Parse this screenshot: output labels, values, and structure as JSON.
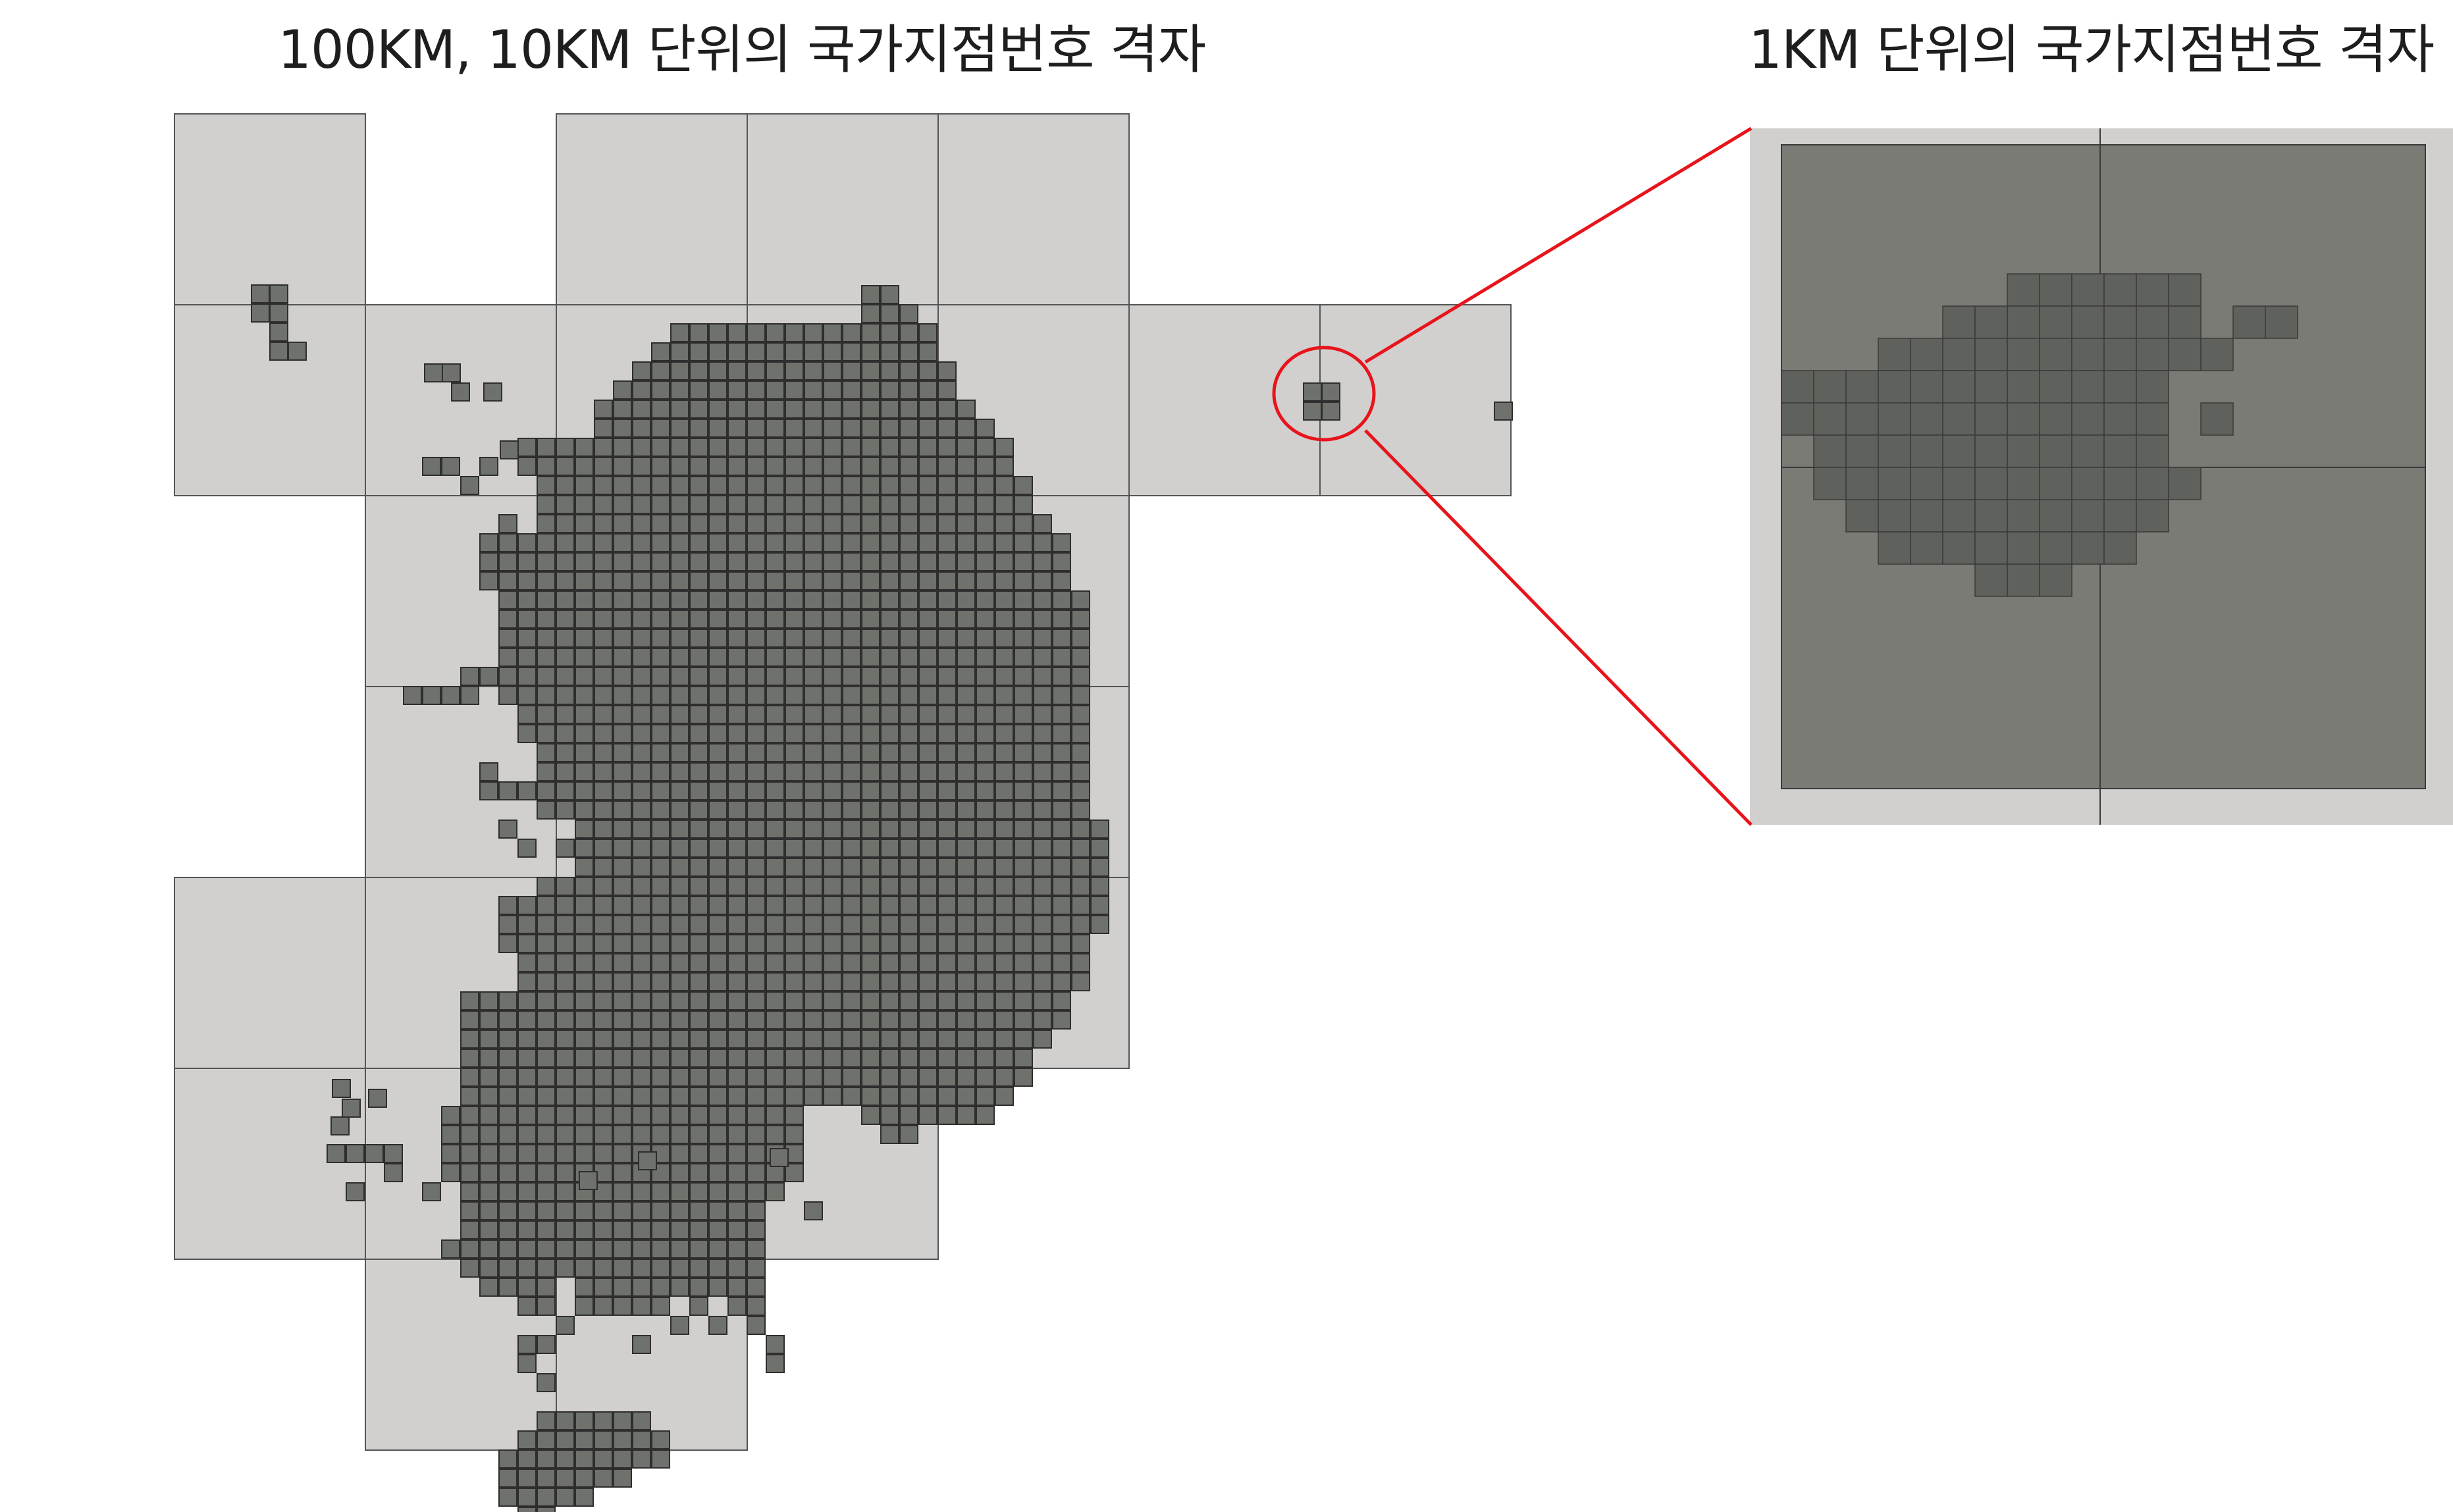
{
  "left_panel": {
    "title": "100KM, 10KM 단위의 국가지점번호 격자"
  },
  "right_panel": {
    "title": "1KM 단위의 국가지점번호 격자"
  },
  "colors": {
    "grid_100km_fill": "#d1d0cf",
    "grid_line": "#555555",
    "cell_10km_fill": "#6f716c",
    "inset_fill": "#7a7b74",
    "cell_1km_fill": "#5f625c",
    "highlight": "#e8141b"
  }
}
